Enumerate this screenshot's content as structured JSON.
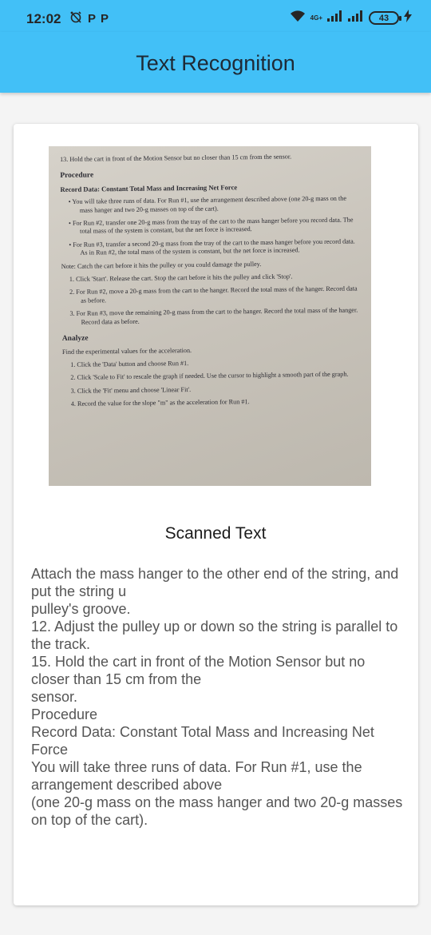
{
  "status_bar": {
    "time": "12:02",
    "left_icons": [
      "alarm-off-icon",
      "p-notification-icon",
      "p-notification-icon"
    ],
    "network_label": "4G+",
    "battery_level": "43"
  },
  "app_bar": {
    "title": "Text Recognition",
    "background_color": "#42c0f7"
  },
  "scanned_image": {
    "lines": [
      "13.  Hold the cart in front of the Motion Sensor but no closer than 15 cm from the sensor.",
      "Procedure",
      "Record Data: Constant Total Mass and Increasing Net Force",
      "•  You will take three runs of data. For Run #1, use the arrangement described above (one 20-g mass on the mass hanger and two 20-g masses on top of the cart).",
      "•  For Run #2, transfer one 20-g mass from the tray of the cart to the mass hanger before you record data. The total mass of the system is constant, but the net force is increased.",
      "•  For Run #3, transfer a second 20-g mass from the tray of the cart to the mass hanger before you record data. As in Run #2, the total mass of the system is constant, but the net force is increased.",
      "Note: Catch the cart before it hits the pulley or you could damage the pulley.",
      "1.  Click 'Start'. Release the cart. Stop the cart before it hits the pulley and click 'Stop'.",
      "2.  For Run #2, move a 20-g mass from the cart to the hanger. Record the total mass of the hanger. Record data as before.",
      "3.  For Run #3, move the remaining 20-g mass from the cart to the hanger. Record the total mass of the hanger. Record data as before.",
      "Analyze",
      "Find the experimental values for the acceleration.",
      "1.  Click the 'Data' button and choose Run #1.",
      "2.  Click 'Scale to Fit' to rescale the graph if needed. Use the cursor to highlight a smooth part of the graph.",
      "3.  Click the 'Fit' menu and choose 'Linear Fit'.",
      "4.  Record the value for the slope \"m\" as the acceleration for Run #1."
    ]
  },
  "scanned_text": {
    "title": "Scanned Text",
    "body": "Attach the mass hanger to the other end of the string, and put the string u\npulley's groove.\n12. Adjust the pulley up or down so the string is parallel to the track.\n15. Hold the cart in front of the Motion Sensor but no closer than 15 cm from the\nsensor.\nProcedure\nRecord Data: Constant Total Mass and Increasing Net Force\nYou will take three runs of data. For Run #1, use the arrangement described above\n(one 20-g mass on the mass hanger and two 20-g masses on top of the cart)."
  }
}
